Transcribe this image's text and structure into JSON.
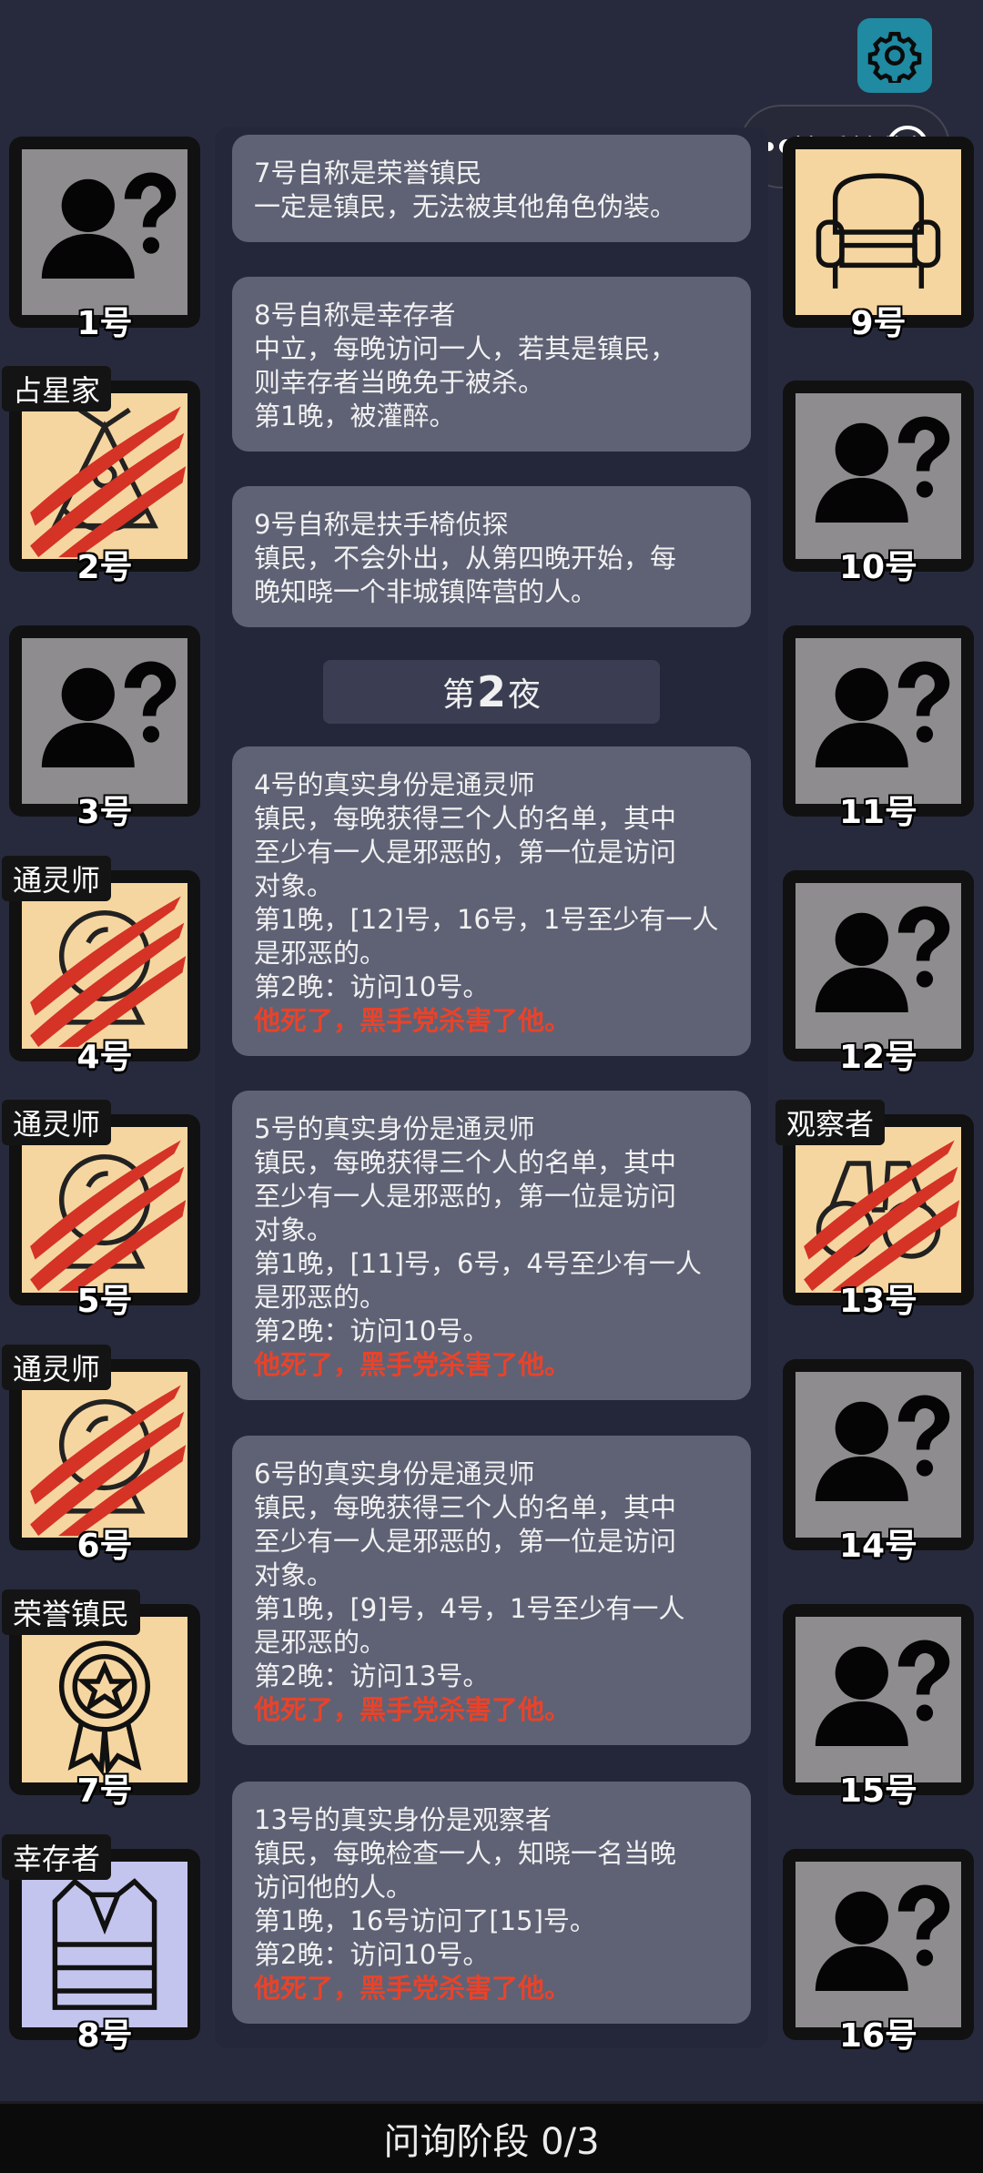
{
  "capsule_text": "扶手椅侦探",
  "players": [
    {
      "num": "1号",
      "tag": "",
      "icon": "unknown-person-icon",
      "state": "unknown"
    },
    {
      "num": "2号",
      "tag": "占星家",
      "icon": "astrologer-sextant-icon",
      "state": "dead"
    },
    {
      "num": "3号",
      "tag": "",
      "icon": "unknown-person-icon",
      "state": "unknown"
    },
    {
      "num": "4号",
      "tag": "通灵师",
      "icon": "crystal-ball-icon",
      "state": "dead"
    },
    {
      "num": "5号",
      "tag": "通灵师",
      "icon": "crystal-ball-icon",
      "state": "dead"
    },
    {
      "num": "6号",
      "tag": "通灵师",
      "icon": "crystal-ball-icon",
      "state": "dead"
    },
    {
      "num": "7号",
      "tag": "荣誉镇民",
      "icon": "medal-icon",
      "state": "alive"
    },
    {
      "num": "8号",
      "tag": "幸存者",
      "icon": "vest-icon",
      "state": "alive"
    },
    {
      "num": "9号",
      "tag": "",
      "icon": "armchair-icon",
      "state": "alive"
    },
    {
      "num": "10号",
      "tag": "",
      "icon": "unknown-person-icon",
      "state": "unknown"
    },
    {
      "num": "11号",
      "tag": "",
      "icon": "unknown-person-icon",
      "state": "unknown"
    },
    {
      "num": "12号",
      "tag": "",
      "icon": "unknown-person-icon",
      "state": "unknown"
    },
    {
      "num": "13号",
      "tag": "观察者",
      "icon": "binoculars-icon",
      "state": "dead"
    },
    {
      "num": "14号",
      "tag": "",
      "icon": "unknown-person-icon",
      "state": "unknown"
    },
    {
      "num": "15号",
      "tag": "",
      "icon": "unknown-person-icon",
      "state": "unknown"
    },
    {
      "num": "16号",
      "tag": "",
      "icon": "unknown-person-icon",
      "state": "unknown"
    }
  ],
  "log": {
    "card1": {
      "l1": "7号自称是荣誉镇民",
      "l2": "一定是镇民，无法被其他角色伪装。"
    },
    "card2": {
      "l1": "8号自称是幸存者",
      "l2": "中立，每晚访问一人，若其是镇民，",
      "l3": "则幸存者当晚免于被杀。",
      "l4": "第1晚，被灌醉。"
    },
    "card3": {
      "l1": "9号自称是扶手椅侦探",
      "l2": "镇民，不会外出，从第四晚开始，每",
      "l3": "晚知晓一个非城镇阵营的人。"
    },
    "night": {
      "prefix": "第",
      "number": "2",
      "suffix": "夜"
    },
    "card4": {
      "l1": "4号的真实身份是通灵师",
      "l2": "镇民，每晚获得三个人的名单，其中",
      "l3": "至少有一人是邪恶的，第一位是访问",
      "l4": "对象。",
      "l5": "第1晚，[12]号，16号，1号至少有一人",
      "l6": "是邪恶的。",
      "l7": "第2晚：访问10号。",
      "dead": "他死了，黑手党杀害了他。"
    },
    "card5": {
      "l1": "5号的真实身份是通灵师",
      "l2": "镇民，每晚获得三个人的名单，其中",
      "l3": "至少有一人是邪恶的，第一位是访问",
      "l4": "对象。",
      "l5": "第1晚，[11]号，6号，4号至少有一人",
      "l6": "是邪恶的。",
      "l7": "第2晚：访问10号。",
      "dead": "他死了，黑手党杀害了他。"
    },
    "card6": {
      "l1": "6号的真实身份是通灵师",
      "l2": "镇民，每晚获得三个人的名单，其中",
      "l3": "至少有一人是邪恶的，第一位是访问",
      "l4": "对象。",
      "l5": "第1晚，[9]号，4号，1号至少有一人",
      "l6": "是邪恶的。",
      "l7": "第2晚：访问13号。",
      "dead": "他死了，黑手党杀害了他。"
    },
    "card7": {
      "l1": "13号的真实身份是观察者",
      "l2": "镇民，每晚检查一人，知晓一名当晚",
      "l3": "访问他的人。",
      "l4": "第1晚，16号访问了[15]号。",
      "l5": "第2晚：访问10号。",
      "dead": "他死了，黑手党杀害了他。"
    }
  },
  "bottom_bar": {
    "label": "问询阶段 0/3"
  },
  "colors": {
    "background": "#272a3d",
    "card": "#5f6275",
    "dead_text": "#e8432a",
    "known_bg": "#f6d6a0",
    "unknown_bg": "#8e8c8e",
    "gear": "#1f8aa1"
  }
}
